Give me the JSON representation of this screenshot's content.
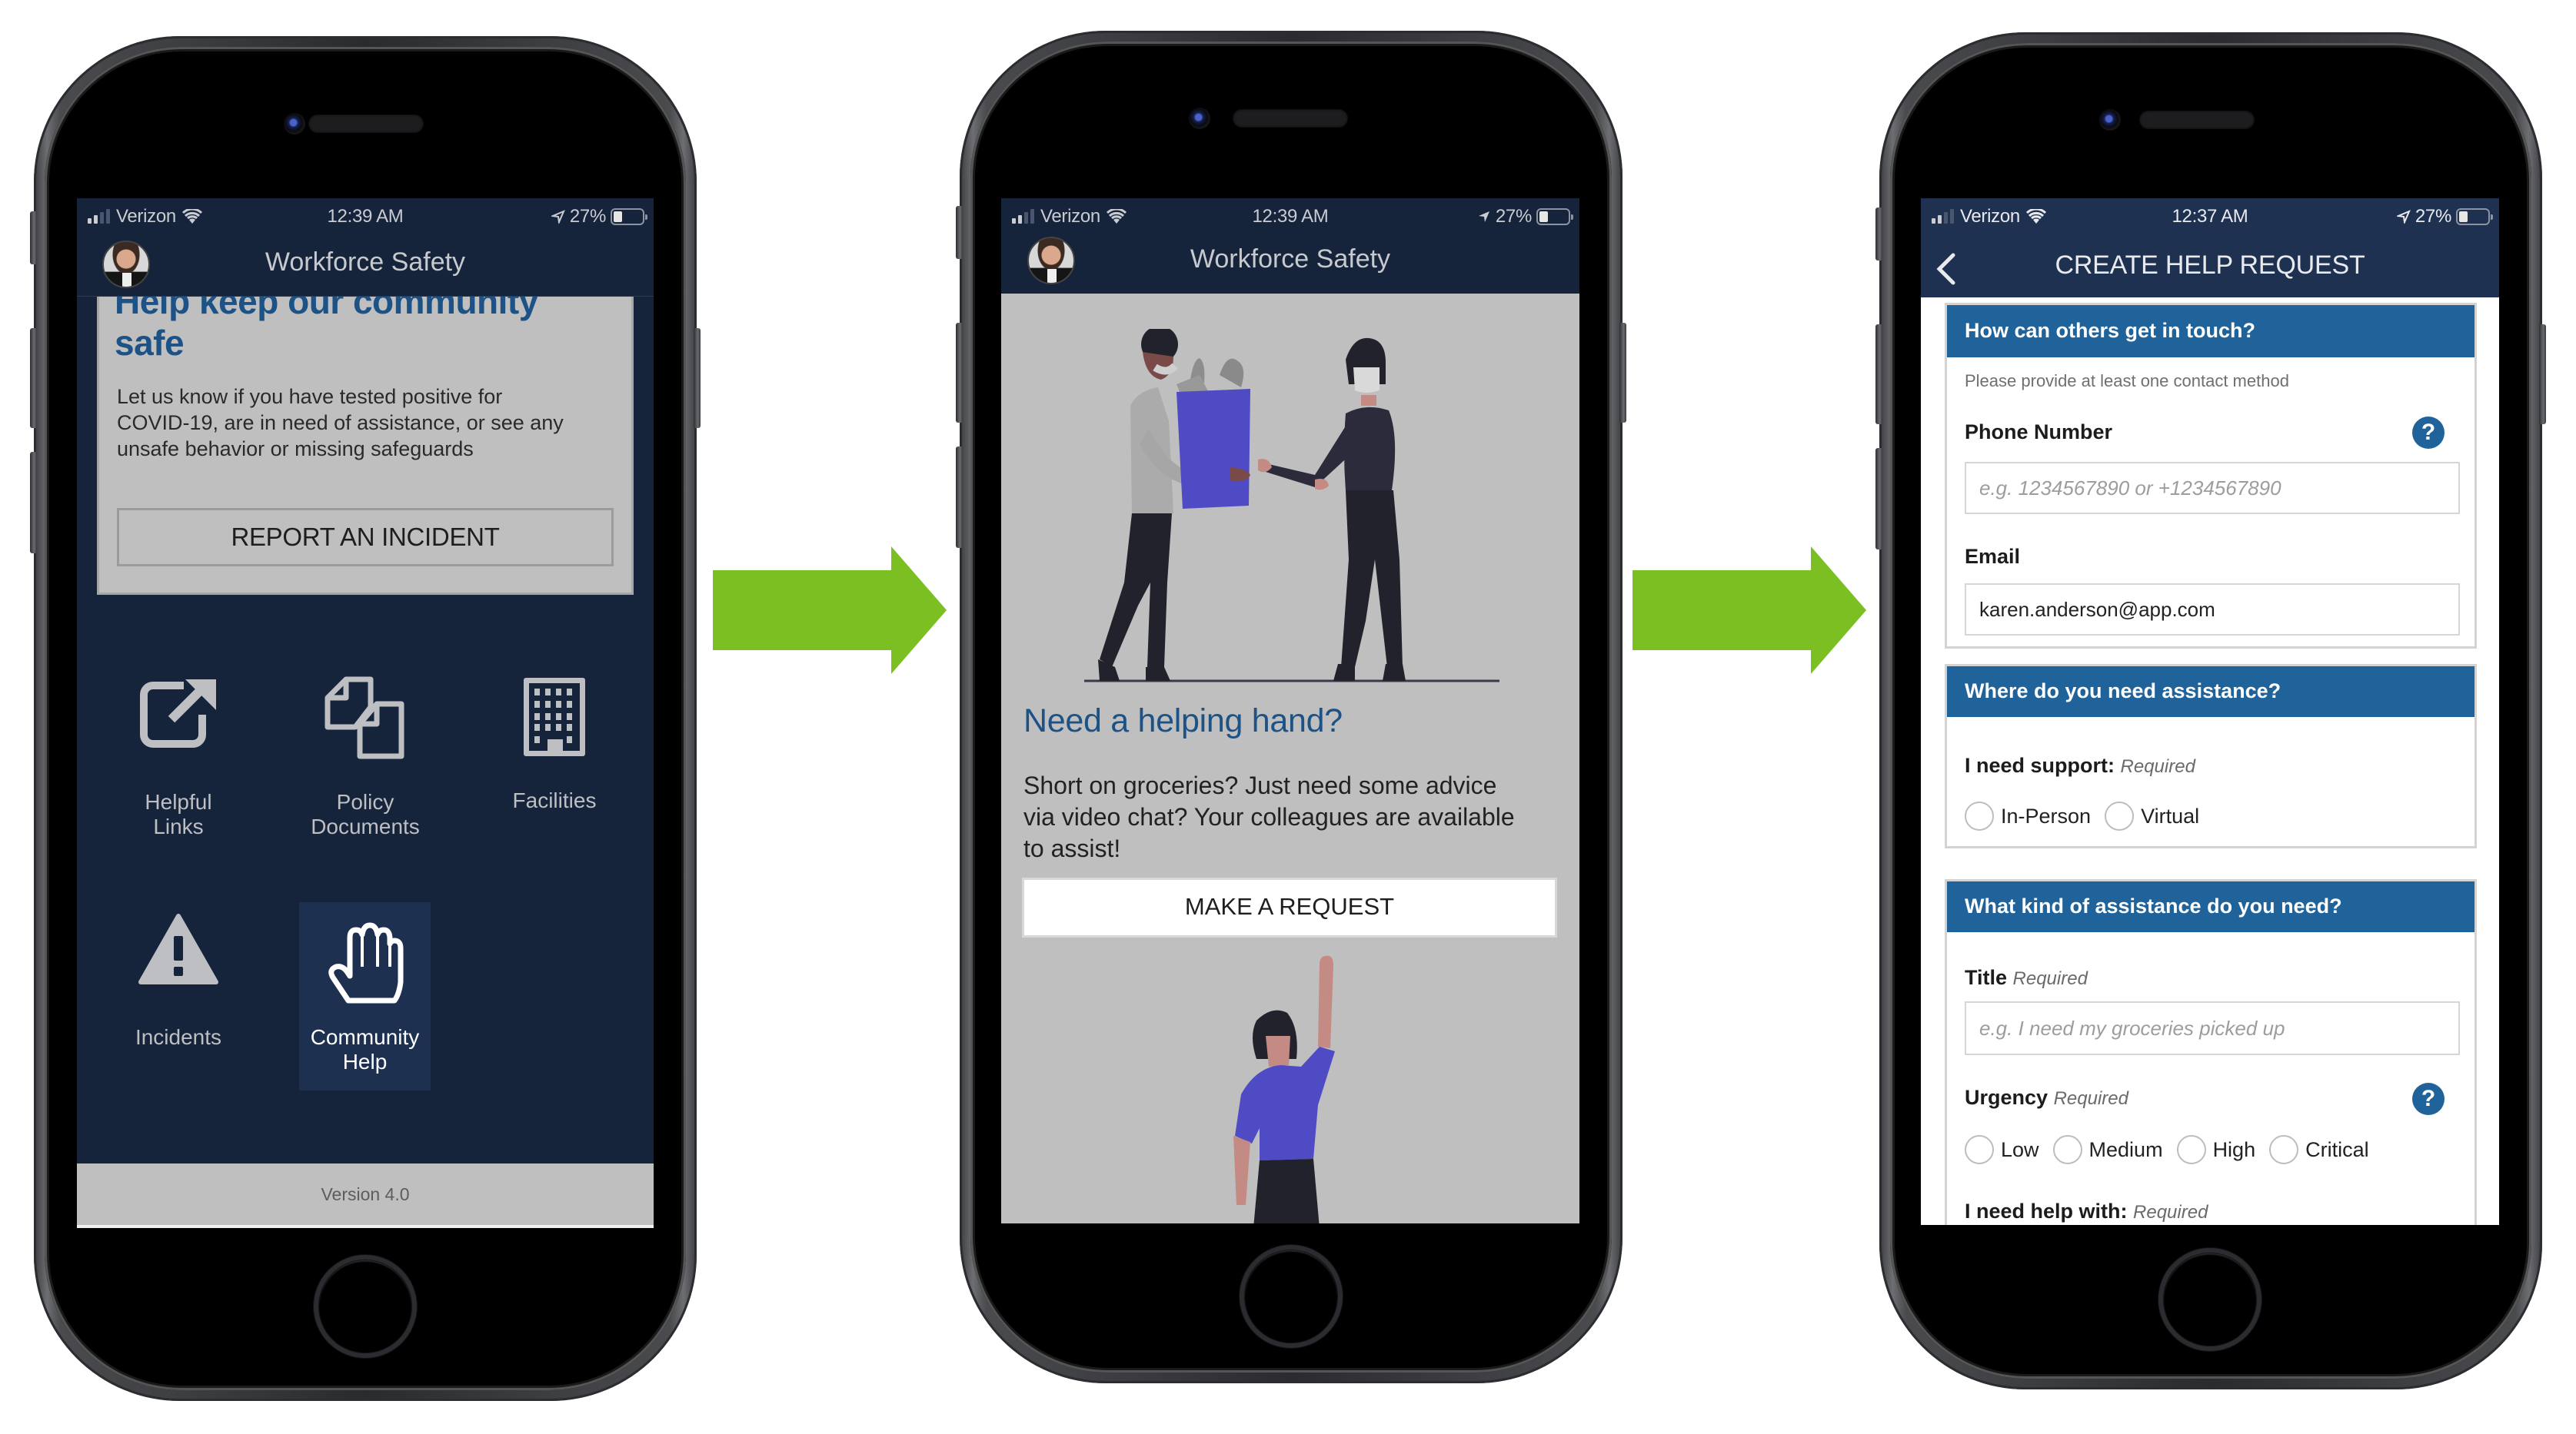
{
  "flow_arrows": [
    {
      "name": "arrow-to-screen-2",
      "color": "#7bbf22"
    },
    {
      "name": "arrow-to-screen-3",
      "color": "#7bbf22"
    }
  ],
  "screens": [
    {
      "status_bar": {
        "carrier": "Verizon",
        "time": "12:39 AM",
        "battery": "27%",
        "battery_level": 0.27
      },
      "header": {
        "title": "Workforce Safety"
      },
      "card": {
        "title_line1": "Help keep our community",
        "title_line2": "safe",
        "body_lines": [
          "Let us know if you have tested positive for",
          "COVID-19, are in need of assistance, or see any",
          "unsafe behavior or missing safeguards"
        ],
        "button_label": "REPORT AN INCIDENT"
      },
      "tiles": [
        {
          "label_line1": "Helpful Links",
          "label_line2": "",
          "icon": "external-link-icon"
        },
        {
          "label_line1": "Policy",
          "label_line2": "Documents",
          "icon": "documents-icon"
        },
        {
          "label_line1": "Facilities",
          "label_line2": "",
          "icon": "building-icon"
        },
        {
          "label_line1": "Incidents",
          "label_line2": "",
          "icon": "warning-icon"
        },
        {
          "label_line1": "Community",
          "label_line2": "Help",
          "icon": "hand-icon",
          "selected": true
        }
      ],
      "footer": {
        "version": "Version 4.0"
      },
      "colors": {
        "background": "#16243b",
        "card": "#bfbfbf",
        "accent_text": "#1c5286",
        "selected_tile": "#1d3050"
      }
    },
    {
      "status_bar": {
        "carrier": "Verizon",
        "time": "12:39 AM",
        "battery": "27%",
        "battery_level": 0.27
      },
      "header": {
        "title": "Workforce Safety"
      },
      "heading": "Need a helping hand?",
      "body_lines": [
        "Short on groceries? Just need some advice",
        "via video chat? Your colleagues are available",
        "to assist!"
      ],
      "button_label": "MAKE A REQUEST",
      "illustrations": [
        "grocery-handoff-illustration",
        "raised-hand-woman-illustration"
      ],
      "colors": {
        "background": "#bfbfbf",
        "accent": "#4f4bc4"
      }
    },
    {
      "status_bar": {
        "carrier": "Verizon",
        "time": "12:37 AM",
        "battery": "27%",
        "battery_level": 0.27
      },
      "header": {
        "title": "CREATE HELP REQUEST",
        "back_icon": "chevron-left-icon"
      },
      "sections": [
        {
          "title": "How can others get in touch?",
          "hint": "Please provide at least one contact method",
          "fields": [
            {
              "label": "Phone Number",
              "placeholder": "e.g. 1234567890 or +1234567890",
              "value": ""
            },
            {
              "label": "Email",
              "placeholder": "",
              "value": "karen.anderson@app.com"
            }
          ]
        },
        {
          "title": "Where do you need assistance?",
          "fields": [
            {
              "label": "I need support:",
              "required": "Required",
              "options": [
                "In-Person",
                "Virtual"
              ],
              "selected": null
            }
          ]
        },
        {
          "title": "What kind of assistance do you need?",
          "fields": [
            {
              "label": "Title",
              "required": "Required",
              "placeholder": "e.g. I need my groceries picked up",
              "value": ""
            },
            {
              "label": "Urgency",
              "required": "Required",
              "options": [
                "Low",
                "Medium",
                "High",
                "Critical"
              ],
              "selected": null
            },
            {
              "label": "I need help with:",
              "required": "Required"
            }
          ]
        }
      ],
      "colors": {
        "section_header": "#20639a",
        "nav": "#1f3151"
      }
    }
  ]
}
